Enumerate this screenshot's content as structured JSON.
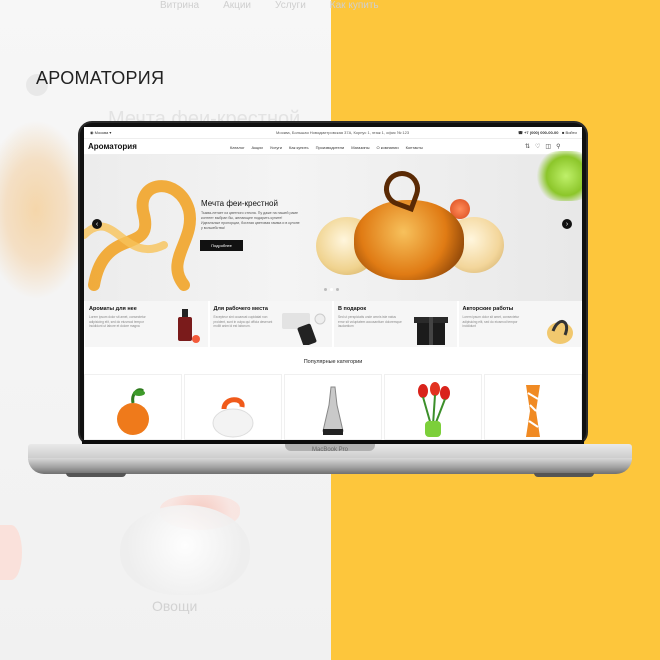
{
  "background": {
    "ghost_nav": [
      "Витрина",
      "Акции",
      "Услуги",
      "Как купить"
    ],
    "ghost_title": "Мечта феи-крестной",
    "ghost_label": "Овощи",
    "accent_right": "#fdc63c"
  },
  "brand": "АРОМАТОРИЯ",
  "device_label": "MacBook Pro",
  "site": {
    "topbar": {
      "city": "Москва",
      "address": "Москва, Большая Новодмитровская 37А, Корпус 1, этаж 1, офис № 123",
      "phone": "+7 (000) 000-00-00",
      "login": "Войти"
    },
    "logo": "Ароматория",
    "nav": [
      "Каталог",
      "Акции",
      "Услуги",
      "Как купить",
      "Производители",
      "Магазины",
      "О компании",
      "Контакты"
    ],
    "header_icons": [
      "compare-icon",
      "favorites-icon",
      "cart-icon",
      "search-icon"
    ],
    "hero": {
      "title": "Мечта феи-крестной",
      "description": "Тыква-летает из цветного стекла. Пу даже на нашей раме контент выбран бы, желающее подарить купите! Идеальные пропорции, богатая цветовая гамма и в кулоне у волшебства!",
      "button": "Подробнее",
      "slides": 3,
      "active_slide": 2
    },
    "promos": [
      {
        "title": "Ароматы для нее",
        "text": "Lorem ipsum dolor sit amet, consectetur adipisicing elit, sed do eiusmod tempor incididunt ut labore et dolore magna"
      },
      {
        "title": "Для рабочего места",
        "text": "Excepteur sint occaecat cupidatat non proident, sunt in culpa qui officia deserunt mollit anim id est laborum."
      },
      {
        "title": "В подарок",
        "text": "Sed ut perspiciatis unde omnis iste natus error sit voluptatem accusantium doloremque laudantium"
      },
      {
        "title": "Авторские работы",
        "text": "Lorem ipsum dolor sit amet, consectetur adipisicing elit, sed do eiusmod tempor incididunt"
      }
    ],
    "categories_title": "Популярные категории"
  }
}
